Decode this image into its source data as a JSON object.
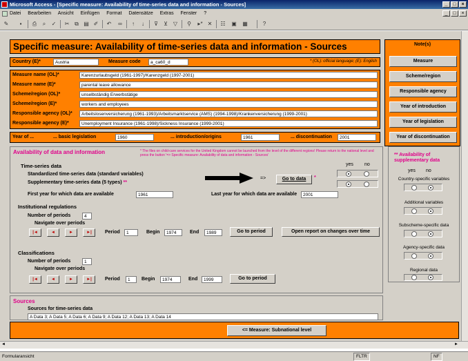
{
  "window": {
    "title": "Microsoft Access - [Specific measure: Availability of time-series data and information - Sources]",
    "controls": [
      "_",
      "□",
      "×"
    ]
  },
  "menu": [
    "Datei",
    "Bearbeiten",
    "Ansicht",
    "Einfügen",
    "Format",
    "Datensätze",
    "Extras",
    "Fenster",
    "?"
  ],
  "form": {
    "header": "Specific measure: Availability of time-series data and information - Sources",
    "country_label": "Country (E)*",
    "country_value": "Austria",
    "measure_code_label": "Measure code",
    "measure_code_value": "a_ca60_d",
    "lang_note": "* (OL): official language; (E): English",
    "rows": [
      {
        "label": "Measure name (OL)*",
        "value": "Karenzurlaubsgeld (1961-1997)/Karenzgeld (1997-2001)"
      },
      {
        "label": "Measure name (E)*",
        "value": "parental leave allowance"
      },
      {
        "label": "Scheme/region (OL)*",
        "value": "unselbständig Erwerbstätige"
      },
      {
        "label": "Scheme/region (E)*",
        "value": "workers and employees"
      },
      {
        "label": "Responsible agency (OL)*",
        "value": "Arbeitslosenversicherung (1961-1993)/Arbeitsmarktservice (AMS) (1994-1998)/Krankenversicherung (1999-2001)"
      },
      {
        "label": "Responsible agency (E)*",
        "value": "Unemployment Insurance (1961-1998)/Sickness Insurance (1999-2001)"
      }
    ],
    "year_label": "Year of ...",
    "basic_label": "... basic legislation",
    "basic_value": "1960",
    "intro_label": "... introduction/origins",
    "intro_value": "1961",
    "discont_label": "... discontinuation",
    "discont_value": "2001"
  },
  "notes_panel": {
    "title": "Note(s)",
    "buttons": [
      "Measure",
      "Scheme/region",
      "Responsible agency",
      "Year of introduction",
      "Year of legislation",
      "Year of discontinuation"
    ]
  },
  "availability": {
    "title": "Availability of data and information",
    "note": "* The files on child-care services for the United Kingdom cannot be launched from the level of the different regions! Please return to the national level and press the button '=> Specific measure: Availability of data and information - Sources'",
    "ts_heading": "Time-series data",
    "std_label": "Standardized time-series data (standard variables)",
    "supp_label": "Supplementary time-series data (5 types)",
    "supp_mark": "**",
    "yes_label": "yes",
    "no_label": "no",
    "arrow_text": "=>",
    "goto_data": "Go to data",
    "goto_star": "*",
    "first_year_label": "First year for which data are available",
    "first_year_value": "1961",
    "last_year_label": "Last year for which data are available",
    "last_year_value": "2001",
    "inst_heading": "Institutional regulations",
    "periods_label": "Number of periods",
    "inst_periods": "4",
    "navigate_label": "Navigate over periods",
    "nav_buttons": [
      "|◄",
      "◄",
      "►",
      "►|"
    ],
    "period_label": "Period",
    "inst_period": "1",
    "begin_label": "Begin",
    "inst_begin": "1974",
    "end_label": "End",
    "inst_end": "1989",
    "goto_period": "Go to period",
    "open_report": "Open report on changes over time",
    "class_heading": "Classifications",
    "class_periods": "1",
    "class_period": "1",
    "class_begin": "1974",
    "class_end": "1999"
  },
  "supplementary": {
    "title": "** Availability of supplementary data",
    "yes_label": "yes",
    "no_label": "no",
    "items": [
      "Country-specific variables",
      "Additional variables",
      "Subscheme-specific data",
      "Agency-specific data",
      "Regional data"
    ]
  },
  "sources": {
    "title": "Sources",
    "subtitle": "Sources for time-series data",
    "value": "A Data 3; A Data 5; A Data 6; A Data 9; A Data 12; A Data 13; A Data 14"
  },
  "footer": {
    "button": "<= Measure: Subnational level"
  },
  "status": {
    "left": "Formularansicht",
    "flt": "FLTR",
    "nf": "NF"
  }
}
